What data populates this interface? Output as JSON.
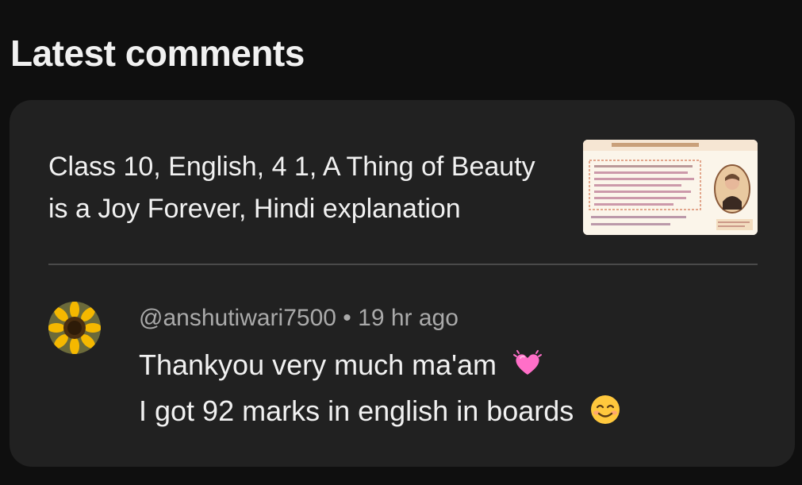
{
  "section": {
    "title": "Latest comments"
  },
  "video": {
    "title": "Class 10, English, 4 1, A Thing of Beauty is a Joy Forever, Hindi explanation",
    "thumbnail_icon": "video-thumbnail"
  },
  "comment": {
    "author": "@anshutiwari7500",
    "separator": "•",
    "time": "19 hr ago",
    "line1": "Thankyou very much ma'am",
    "line1_emoji": "heart-emoji",
    "line2": "I got 92 marks in english in boards",
    "line2_emoji": "smiling-face-emoji",
    "avatar_icon": "sunflower-avatar"
  },
  "colors": {
    "background": "#0f0f0f",
    "card": "#212121",
    "text_primary": "#f1f1f1",
    "text_secondary": "#aaaaaa"
  }
}
